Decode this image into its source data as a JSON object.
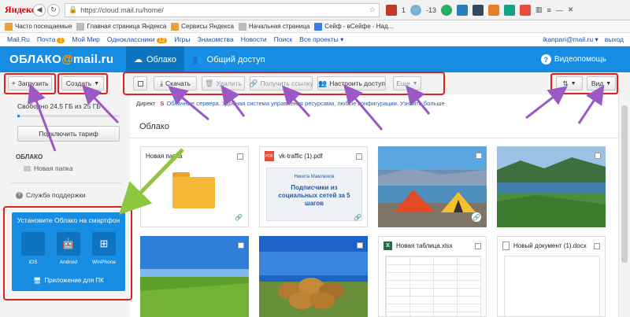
{
  "browser": {
    "logo": "Яндекс",
    "url": "https://cloud.mail.ru/home/",
    "badges": [
      "1",
      "-13"
    ]
  },
  "bookmarks": [
    {
      "label": "Часто посещаемые",
      "color": "#e8a23c"
    },
    {
      "label": "Главная страница Яндекса",
      "color": "#bbbbbb"
    },
    {
      "label": "Сервисы Яндекса",
      "color": "#e8a23c"
    },
    {
      "label": "Начальная страница",
      "color": "#bbbbbb"
    },
    {
      "label": "Сейф - вСейфе - Над...",
      "color": "#3c7de8"
    }
  ],
  "portal": {
    "items": [
      {
        "label": "Mail.Ru"
      },
      {
        "label": "Почта",
        "badge": "1"
      },
      {
        "label": "Мой Мир"
      },
      {
        "label": "Одноклассники",
        "badge": "12"
      },
      {
        "label": "Игры"
      },
      {
        "label": "Знакомства"
      },
      {
        "label": "Новости"
      },
      {
        "label": "Поиск"
      },
      {
        "label": "Все проекты ▾"
      }
    ],
    "email": "ikanpari@mail.ru ▾",
    "logout": "выход"
  },
  "header": {
    "logo_main": "ОБЛАКО",
    "logo_at": "@",
    "logo_domain": "mail.ru",
    "tab_cloud": "Облако",
    "tab_shared": "Общий доступ",
    "help": "Видеопомощь"
  },
  "toolbar": {
    "upload": "Загрузить",
    "create": "Создать",
    "download": "Скачать",
    "delete": "Удалить",
    "get_link": "Получить ссылку",
    "share": "Настроить доступ",
    "more": "Еще",
    "view": "Вид"
  },
  "sidebar": {
    "storage": "Свободно 24,5 ГБ из 25 ГБ",
    "storage_used_fraction": 0.02,
    "tariff": "Подключить тариф",
    "section": "ОБЛАКО",
    "folder": "Новая папка",
    "support": "Служба поддержки",
    "app_title": "Установите Облако на смартфон",
    "apps": [
      "iOS",
      "Android",
      "WinPhone"
    ],
    "pc_app": "Приложение для ПК"
  },
  "main": {
    "ad_direct": "Директ",
    "ad_text": "Облачные сервера. Удобная система управления ресурсами, любые конфигурации. Узнайте больше",
    "breadcrumb": "Облако",
    "files": [
      {
        "name": "Новая папка",
        "kind": "folder"
      },
      {
        "name": "vk-traffic (1).pdf",
        "kind": "pdf",
        "preview_title": "Никита Мамлюков",
        "preview_text": "Подписчики из социальных сетей за 5 шагов"
      },
      {
        "name": "",
        "kind": "photo-tents"
      },
      {
        "name": "",
        "kind": "photo-lake"
      },
      {
        "name": "",
        "kind": "photo-field"
      },
      {
        "name": "",
        "kind": "photo-hay"
      },
      {
        "name": "Новая таблица.xlsx",
        "kind": "xlsx"
      },
      {
        "name": "Новый документ (1).docx",
        "kind": "docx"
      }
    ]
  },
  "colors": {
    "brand_blue": "#168de2",
    "annotation_red": "#e02020",
    "annotation_purple": "#9b59c6",
    "annotation_green": "#8dc63f"
  }
}
